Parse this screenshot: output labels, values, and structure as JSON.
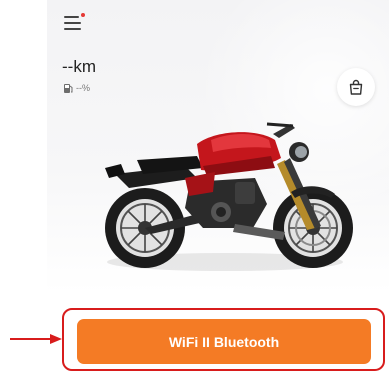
{
  "header": {
    "menu_icon": "hamburger-menu-icon",
    "notification_dot_color": "#e53935"
  },
  "status": {
    "distance": "--km",
    "fuel_icon": "fuel-pump-icon",
    "fuel": "--%"
  },
  "shop": {
    "icon": "shopping-bag-icon"
  },
  "vehicle": {
    "image": "red-motorcycle"
  },
  "connect": {
    "label": "WiFi II Bluetooth",
    "color": "#f47b25"
  },
  "annotation": {
    "color": "#d81c1c",
    "arrow_icon": "arrow-right-icon"
  }
}
